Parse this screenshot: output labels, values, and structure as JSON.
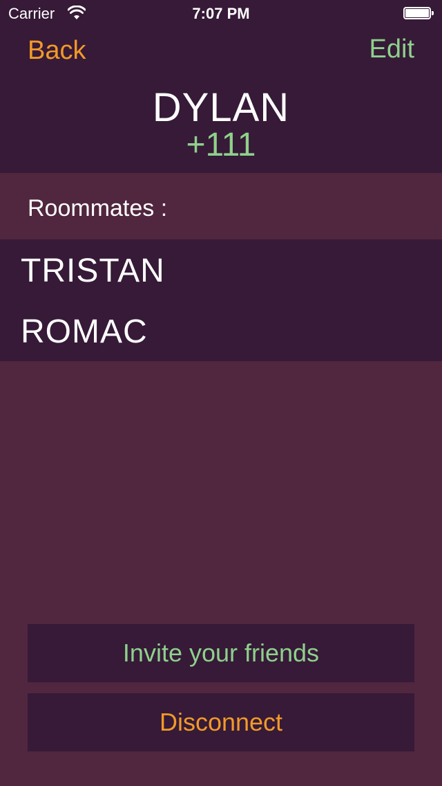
{
  "status_bar": {
    "carrier": "Carrier",
    "time": "7:07 PM",
    "wifi_icon": "wifi-icon",
    "battery_icon": "battery-icon",
    "battery_level": 1.0
  },
  "header": {
    "back_label": "Back",
    "edit_label": "Edit",
    "user_name": "DYLAN",
    "user_score": "+111"
  },
  "roommates": {
    "label": "Roommates :",
    "items": [
      "TRISTAN",
      "ROMAC"
    ]
  },
  "actions": {
    "invite_label": "Invite your friends",
    "disconnect_label": "Disconnect"
  },
  "colors": {
    "background": "#51263f",
    "panel": "#361a37",
    "accent_orange": "#f19a2a",
    "accent_green": "#8fd08d",
    "text": "#ffffff"
  }
}
